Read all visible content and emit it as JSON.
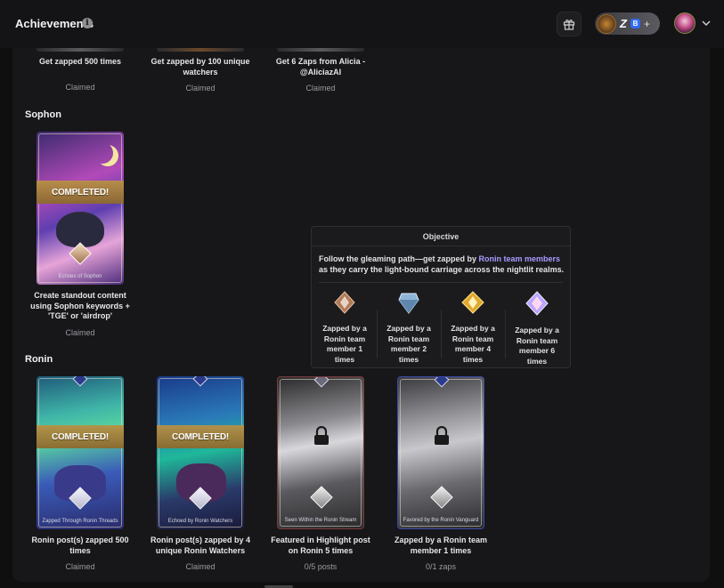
{
  "header": {
    "title": "Achievements",
    "info_icon": "info-icon",
    "gift_icon": "gift-icon",
    "wallet_pill": {
      "z_label": "Z",
      "badge_label": "B",
      "plus_label": "+"
    }
  },
  "top_row": [
    {
      "desc": "Get zapped 500 times",
      "status": "Claimed"
    },
    {
      "desc": "Get zapped by 100 unique watchers",
      "status": "Claimed"
    },
    {
      "desc": "Get 6 Zaps from Alicia - @AliciazAI",
      "status": "Claimed"
    }
  ],
  "sophon": {
    "heading": "Sophon",
    "cards": [
      {
        "caption": "Echoes of Sophon",
        "banner": "COMPLETED!",
        "desc": "Create standout content using Sophon keywords + 'TGE' or 'airdrop'",
        "status": "Claimed"
      }
    ]
  },
  "ronin": {
    "heading": "Ronin",
    "cards": [
      {
        "caption": "Zapped Through Ronin Threads",
        "banner": "COMPLETED!",
        "desc": "Ronin post(s) zapped 500 times",
        "status": "Claimed",
        "locked": false
      },
      {
        "caption": "Echoed by Ronin Watchers",
        "banner": "COMPLETED!",
        "desc": "Ronin post(s) zapped by 4 unique Ronin Watchers",
        "status": "Claimed",
        "locked": false
      },
      {
        "caption": "Seen Within the Ronin Stream",
        "banner": "",
        "desc": "Featured in Highlight post on Ronin 5 times",
        "status": "0/5 posts",
        "locked": true
      },
      {
        "caption": "Favored by the Ronin Vanguard",
        "banner": "",
        "desc": "Zapped by a Ronin team member 1 times",
        "status": "0/1 zaps",
        "locked": true
      }
    ]
  },
  "tooltip": {
    "heading": "Objective",
    "text_before": "Follow the gleaming path—get zapped by ",
    "text_highlight": "Ronin team members",
    "text_after": " as they carry the light-bound carriage across the nightlit realms.",
    "tiers": [
      {
        "label": "Zapped by a Ronin team member 1 times",
        "color": "#b07a5a"
      },
      {
        "label": "Zapped by a Ronin team member 2 times",
        "color": "#8fb5d6"
      },
      {
        "label": "Zapped by a Ronin team member 4 times",
        "color": "#e0a92e"
      },
      {
        "label": "Zapped by a Ronin team member 6 times",
        "color": "#b8a6ff"
      }
    ]
  },
  "colors": {
    "accent_link": "#a89bff",
    "banner_gold": "#b8914a"
  }
}
